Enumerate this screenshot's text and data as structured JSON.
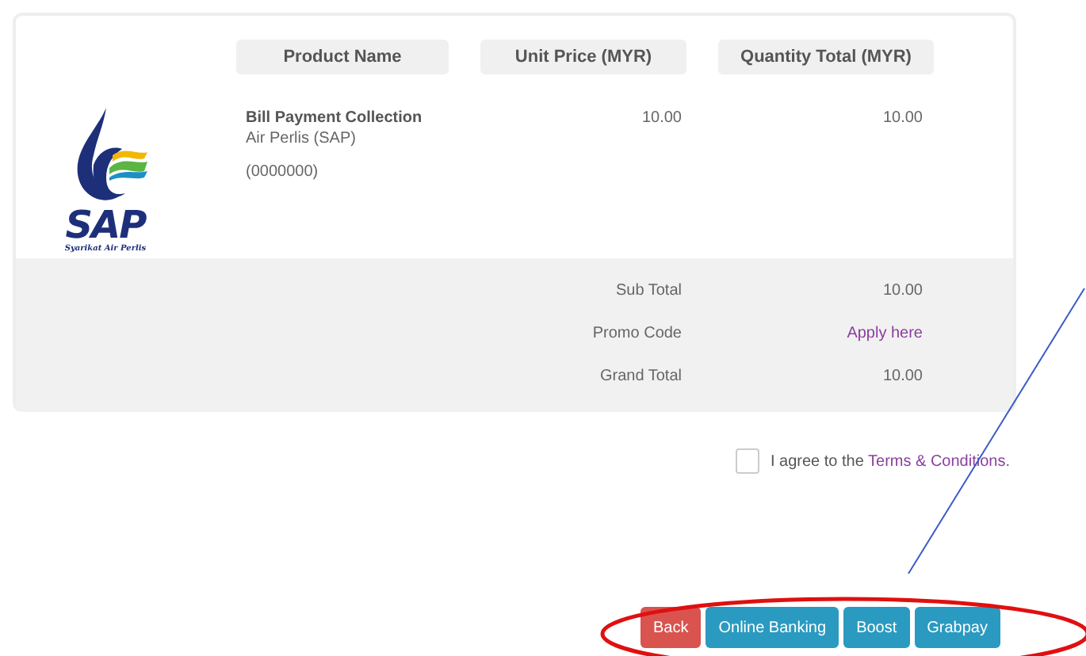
{
  "table": {
    "columns": [
      "Product Name",
      "Unit Price (MYR)",
      "Quantity Total (MYR)"
    ],
    "logo": {
      "title": "SAP",
      "subtitle": "Syarikat Air Perlis"
    },
    "rows": [
      {
        "name": "Bill Payment Collection",
        "biller": "Air Perlis (SAP)",
        "account": "(0000000)",
        "unit_price": "10.00",
        "quantity_total": "10.00"
      }
    ]
  },
  "summary": [
    {
      "label": "Sub Total",
      "value": "10.00",
      "kind": "text"
    },
    {
      "label": "Promo Code",
      "value": "Apply here",
      "kind": "link"
    },
    {
      "label": "Grand Total",
      "value": "10.00",
      "kind": "text"
    }
  ],
  "agreement": {
    "checked": false,
    "text": "I agree to the ",
    "link": "Terms & Conditions."
  },
  "buttons": [
    {
      "label": "Back",
      "kind": "danger"
    },
    {
      "label": "Online Banking",
      "kind": "info"
    },
    {
      "label": "Boost",
      "kind": "info"
    },
    {
      "label": "Grabpay",
      "kind": "info"
    }
  ]
}
